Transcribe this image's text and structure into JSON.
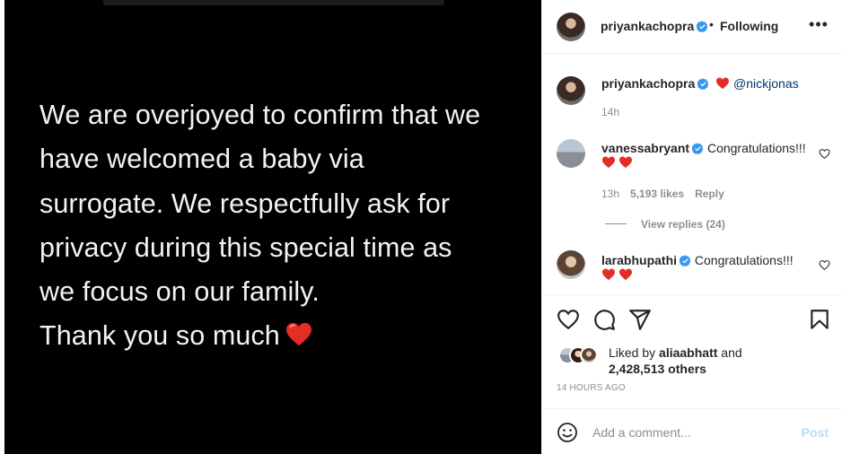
{
  "post_text": {
    "lines": [
      "We are overjoyed to confirm that we",
      "have welcomed a baby via",
      "surrogate. We respectfully ask for",
      "privacy during this special time as",
      "we focus on our family.",
      "Thank you so much"
    ]
  },
  "header": {
    "username": "priyankachopra",
    "separator": "•",
    "follow_status": "Following",
    "more_icon": "more-horizontal-icon"
  },
  "caption": {
    "username": "priyankachopra",
    "mention": "@nickjonas",
    "time": "14h"
  },
  "comments": [
    {
      "username": "vanessabryant",
      "text": "Congratulations!!!",
      "time": "13h",
      "likes": "5,193 likes",
      "reply": "Reply",
      "view_replies": "View replies (24)"
    },
    {
      "username": "larabhupathi",
      "text": "Congratulations!!!"
    }
  ],
  "likes": {
    "prefix": "Liked by",
    "user": "aliaabhatt",
    "and": "and",
    "others": "2,428,513 others"
  },
  "timestamp": "14 HOURS AGO",
  "add_comment": {
    "placeholder": "Add a comment...",
    "post_label": "Post"
  },
  "colors": {
    "verified_blue": "#3897f0",
    "heart_red": "#ed4956",
    "post_disabled": "#b2dffc",
    "link": "#00376b"
  }
}
